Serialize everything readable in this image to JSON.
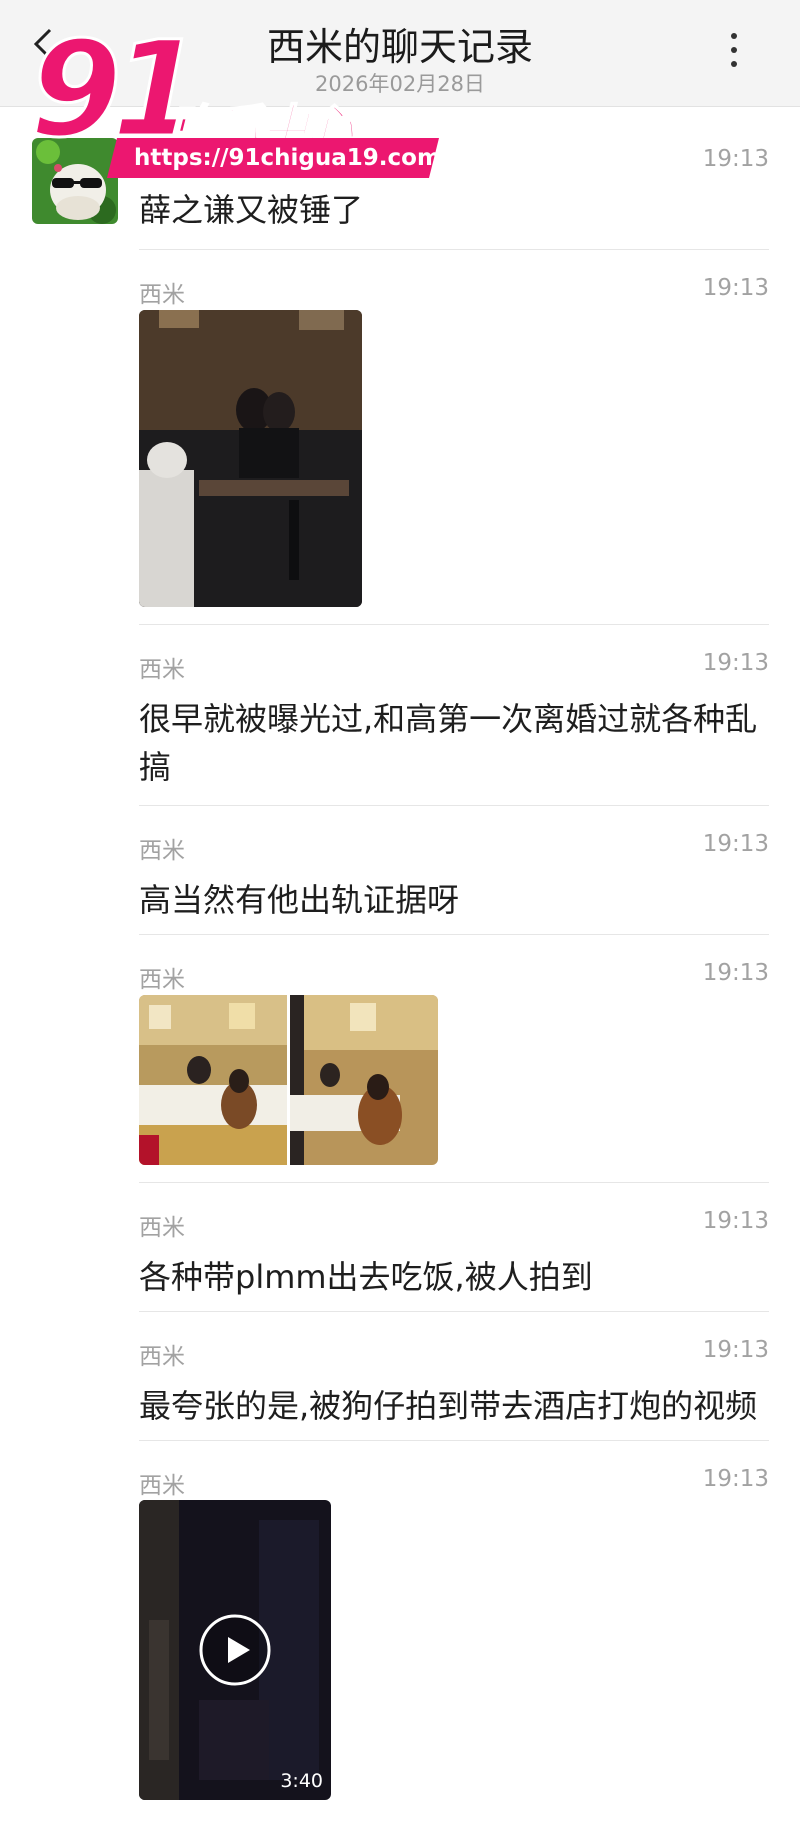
{
  "header": {
    "title": "西米的聊天记录",
    "date": "2026年02月28日"
  },
  "watermark": {
    "number": "91",
    "name": "吃瓜中心",
    "url": "https://91chigua19.com"
  },
  "messages": [
    {
      "sender": "",
      "time": "19:13",
      "text": "薛之谦又被锤了"
    },
    {
      "sender": "西米",
      "time": "19:13"
    },
    {
      "sender": "西米",
      "time": "19:13",
      "text": "很早就被曝光过,和高第一次离婚过就各种乱搞"
    },
    {
      "sender": "西米",
      "time": "19:13",
      "text": "高当然有他出轨证据呀"
    },
    {
      "sender": "西米",
      "time": "19:13"
    },
    {
      "sender": "西米",
      "time": "19:13",
      "text": "各种带plmm出去吃饭,被人拍到"
    },
    {
      "sender": "西米",
      "time": "19:13",
      "text": "最夸张的是,被狗仔拍到带去酒店打炮的视频"
    },
    {
      "sender": "西米",
      "time": "19:13",
      "video_duration": "3:40"
    }
  ]
}
